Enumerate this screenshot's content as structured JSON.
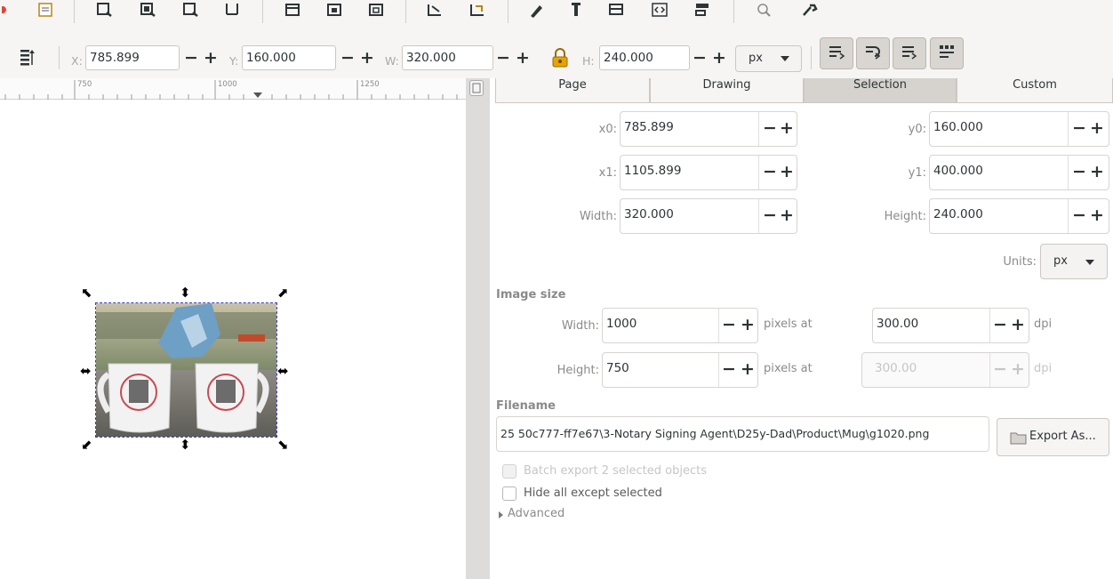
{
  "toolbar": {
    "icons": [
      "close-icon",
      "document-properties-icon",
      "zoom-selection-icon",
      "zoom-drawing-icon",
      "zoom-page-icon",
      "zoom-width-icon",
      "duplicate-icon",
      "clone-icon",
      "unlink-clone-icon",
      "group-icon",
      "ungroup-icon",
      "fill-stroke-icon",
      "text-font-icon",
      "layers-icon",
      "xml-editor-icon",
      "align-distribute-icon",
      "preferences-icon",
      "tools-icon"
    ]
  },
  "controls": {
    "x_label": "X:",
    "x_value": "785.899",
    "y_label": "Y:",
    "y_value": "160.000",
    "w_label": "W:",
    "w_value": "320.000",
    "h_label": "H:",
    "h_value": "240.000",
    "minus": "−",
    "plus": "+",
    "units": "px",
    "lock_state": "locked"
  },
  "ruler": {
    "labels": [
      "750",
      "1000",
      "1250"
    ]
  },
  "export": {
    "tabs": [
      "Page",
      "Drawing",
      "Selection",
      "Custom"
    ],
    "active_tab": "Selection",
    "x0_label": "x0:",
    "x0_value": "785.899",
    "y0_label": "y0:",
    "y0_value": "160.000",
    "x1_label": "x1:",
    "x1_value": "1105.899",
    "y1_label": "y1:",
    "y1_value": "400.000",
    "width_label": "Width:",
    "width_value": "320.000",
    "height_label": "Height:",
    "height_value": "240.000",
    "units_label": "Units:",
    "units_value": "px",
    "image_size_heading": "Image size",
    "img_width_label": "Width:",
    "img_width_value": "1000",
    "img_height_label": "Height:",
    "img_height_value": "750",
    "pixels_at": "pixels at",
    "dpi_value": "300.00",
    "dpi_value_disabled": "300.00",
    "dpi_label": "dpi",
    "filename_heading": "Filename",
    "filename": "25 50c777-ff7e67\\3-Notary Signing Agent\\D25y-Dad\\Product\\Mug\\g1020.png",
    "export_as_label": "Export As...",
    "batch_export_label": "Batch export 2 selected objects",
    "hide_all_label": "Hide all except selected",
    "advanced_label": "Advanced"
  },
  "colors": {
    "selection_dash": "#3b3bbf",
    "panel_bg": "#f6f5f4",
    "active_tab": "#d6d2ce"
  }
}
